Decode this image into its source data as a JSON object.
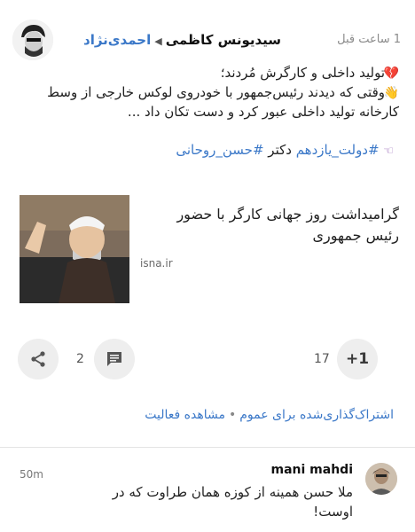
{
  "header": {
    "author": "سیدیونس کاظمی",
    "target": "احمدی‌نژاد",
    "time": "1 ساعت قبل"
  },
  "post": {
    "line1": "تولید داخلی و کارگرش مُردند؛",
    "line2": "وقتی که دیدند رئیس‌جمهور با خودروی لوکس خارجی از وسط",
    "line3": "کارخانه تولید داخلی عبور کرد و دست تکان داد ..."
  },
  "tags": {
    "tag1": "#دولت_یازدهم",
    "plain": "دکتر",
    "tag2": "#حسن_روحانی"
  },
  "link_card": {
    "title": "گرامیداشت روز جهانی کارگر با حضور رئیس جمهوری",
    "domain": "isna.ir"
  },
  "actions": {
    "comment_count": "2",
    "plus_count": "17",
    "plus_label": "+1"
  },
  "meta": {
    "shared_text": "اشتراک‌گذاری‌شده برای عموم",
    "activity_text": "مشاهده فعالیت"
  },
  "comment": {
    "name": "mani mahdi",
    "text": "ملا حسن همینه از کوزه همان طراوت که در اوست!",
    "time": "50m"
  },
  "icons": {
    "heart": "broken-heart-icon",
    "hand": "waving-hand-icon",
    "point": "pointing-hand-icon"
  }
}
